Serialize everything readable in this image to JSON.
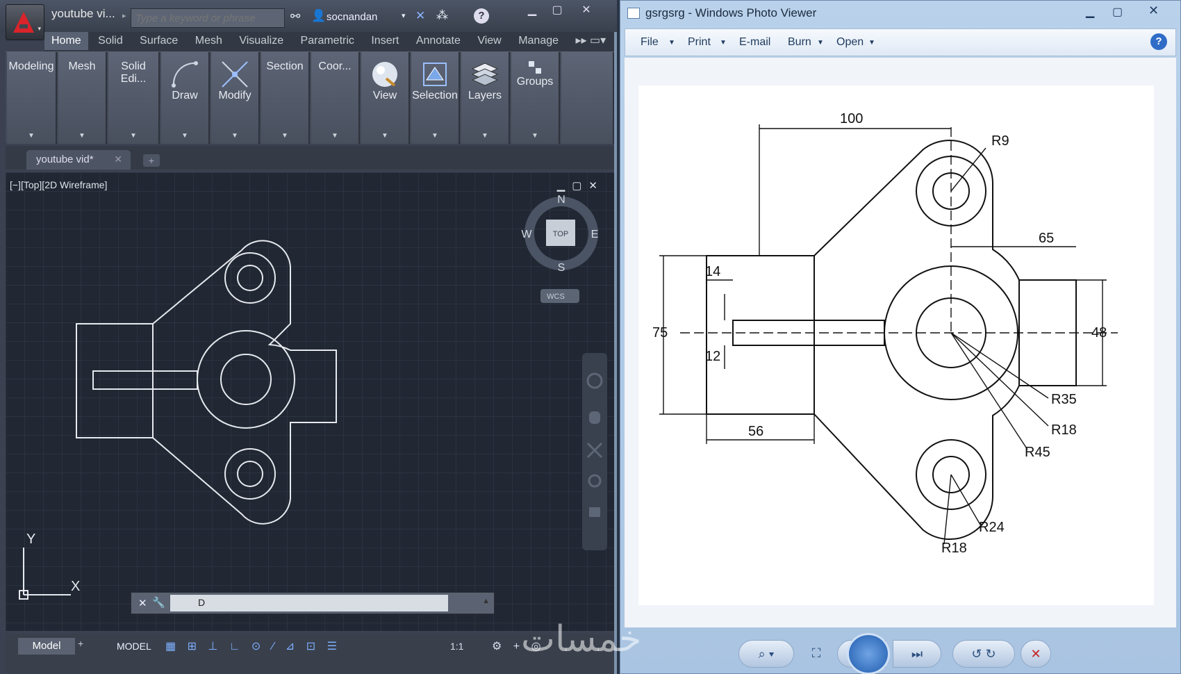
{
  "autocad": {
    "doc_title": "youtube vi...",
    "search_placeholder": "Type a keyword or phrase",
    "user": "socnandan",
    "ribbon_tabs": [
      "Home",
      "Solid",
      "Surface",
      "Mesh",
      "Visualize",
      "Parametric",
      "Insert",
      "Annotate",
      "View",
      "Manage"
    ],
    "panels": [
      "Modeling",
      "Mesh",
      "Solid Edi...",
      "Draw",
      "Modify",
      "Section",
      "Coor...",
      "View",
      "Selection",
      "Layers",
      "Groups"
    ],
    "doc_tab": "youtube vid*",
    "viewport_label": "[−][Top][2D Wireframe]",
    "viewcube": {
      "top": "TOP",
      "n": "N",
      "s": "S",
      "e": "E",
      "w": "W",
      "wcs": "WCS"
    },
    "ucs": {
      "x": "X",
      "y": "Y"
    },
    "command_text": "D",
    "model_tab": "Model",
    "status_model": "MODEL",
    "scale": "1:1"
  },
  "photo_viewer": {
    "title": "gsrgsrg - Windows Photo Viewer",
    "menu": [
      "File",
      "Print",
      "E-mail",
      "Burn",
      "Open"
    ],
    "help": "?"
  },
  "drawing": {
    "dim_100": "100",
    "dim_r9": "R9",
    "dim_65": "65",
    "dim_14": "14",
    "dim_75": "75",
    "dim_48": "48",
    "dim_12": "12",
    "dim_r35": "R35",
    "dim_56": "56",
    "dim_r18a": "R18",
    "dim_r45": "R45",
    "dim_r24": "R24",
    "dim_r18b": "R18"
  },
  "watermark": "خمسات"
}
